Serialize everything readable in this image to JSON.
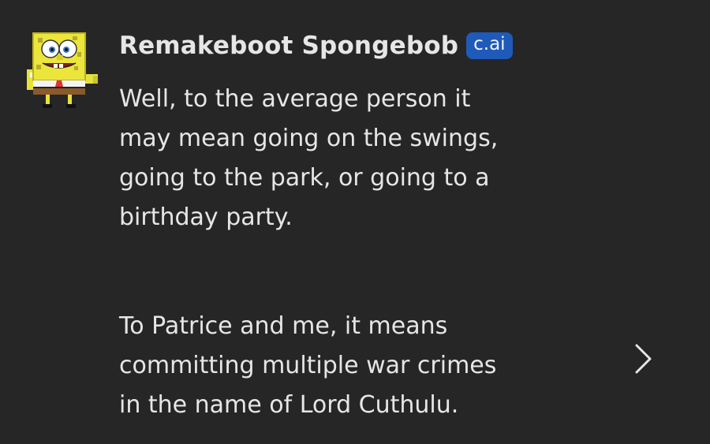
{
  "author": {
    "name": "Remakeboot Spongebob",
    "badge": "c.ai",
    "avatar_icon": "spongebob-pixel-avatar"
  },
  "message": {
    "paragraphs": [
      "Well, to the average person it\nmay mean going on the swings,\ngoing to the park, or going to a\nbirthday party.",
      "To Patrice and me, it means\ncommitting multiple war crimes\nin the name of Lord Cuthulu."
    ]
  },
  "controls": {
    "next_icon": "chevron-right-icon"
  },
  "colors": {
    "background": "#262626",
    "text": "#e6e6e6",
    "badge_bg": "#1f5ab8"
  }
}
